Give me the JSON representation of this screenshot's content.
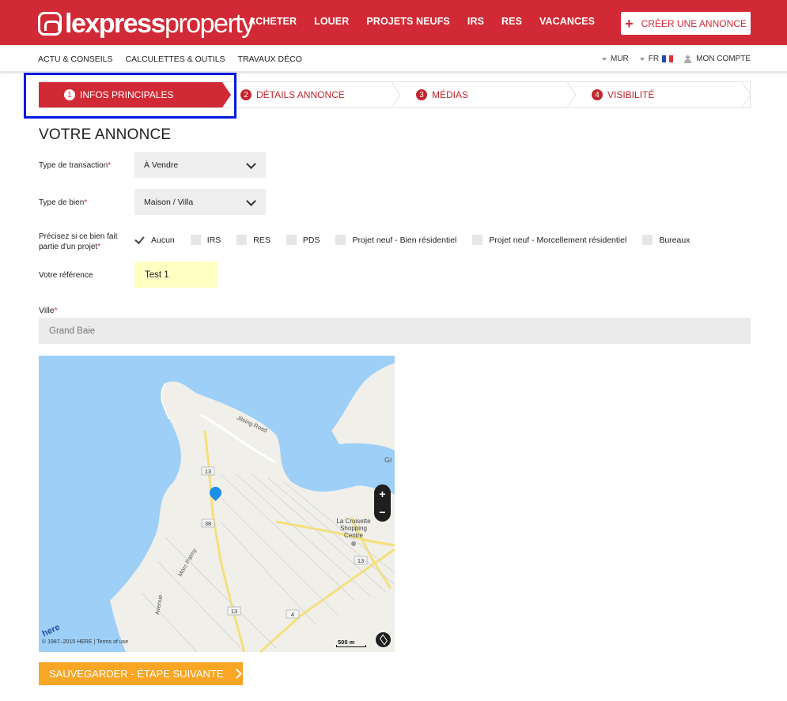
{
  "header": {
    "logo_bold": "lexpress",
    "logo_light": "property",
    "nav": [
      "ACHETER",
      "LOUER",
      "PROJETS NEUFS",
      "IRS",
      "RES",
      "VACANCES"
    ],
    "create_label": "CRÉER UNE ANNONCE"
  },
  "subnav": {
    "links": [
      "ACTU & CONSEILS",
      "CALCULETTES & OUTILS",
      "TRAVAUX DÉCO"
    ],
    "currency": "MUR",
    "language": "FR",
    "account": "MON COMPTE"
  },
  "steps": [
    {
      "num": "1",
      "label": "INFOS PRINCIPALES"
    },
    {
      "num": "2",
      "label": "DÉTAILS ANNONCE"
    },
    {
      "num": "3",
      "label": "MÉDIAS"
    },
    {
      "num": "4",
      "label": "VISIBILITÉ"
    }
  ],
  "form": {
    "title": "VOTRE ANNONCE",
    "transaction_label": "Type de transaction",
    "transaction_value": "À Vendre",
    "bien_label": "Type de bien",
    "bien_value": "Maison / Villa",
    "projet_label_1": "Précisez si ce bien fait",
    "projet_label_2": "partie d'un projet",
    "projet_options": [
      {
        "label": "Aucun",
        "checked": true
      },
      {
        "label": "IRS",
        "checked": false
      },
      {
        "label": "RES",
        "checked": false
      },
      {
        "label": "PDS",
        "checked": false
      },
      {
        "label": "Projet neuf - Bien résidentiel",
        "checked": false
      },
      {
        "label": "Projet neuf - Morcellement résidentiel",
        "checked": false
      },
      {
        "label": "Bureaux",
        "checked": false
      }
    ],
    "reference_label": "Votre référence",
    "reference_value": "Test 1",
    "ville_label": "Ville",
    "ville_placeholder": "Grand Baie",
    "required_mark": "*"
  },
  "map": {
    "road_name": "Jitsing Road",
    "road_name_2": "Morc Palmy",
    "road_name_3": "Avenue",
    "poi": [
      "La Croisette",
      "Shopping",
      "Centre"
    ],
    "route_labels": [
      "13",
      "38",
      "13",
      "4",
      "13"
    ],
    "zoom_in": "+",
    "zoom_out": "−",
    "scale": "500 m",
    "copyright": "© 1987–2015 HERE | Terms of use",
    "brand": "here",
    "town_partial": "Gr"
  },
  "footer": {
    "save_label": "SAUVEGARDER - ÉTAPE SUIVANTE"
  },
  "colors": {
    "brand_red": "#d12a36",
    "save_orange": "#f8a623",
    "highlight_blue": "#0019e0"
  }
}
